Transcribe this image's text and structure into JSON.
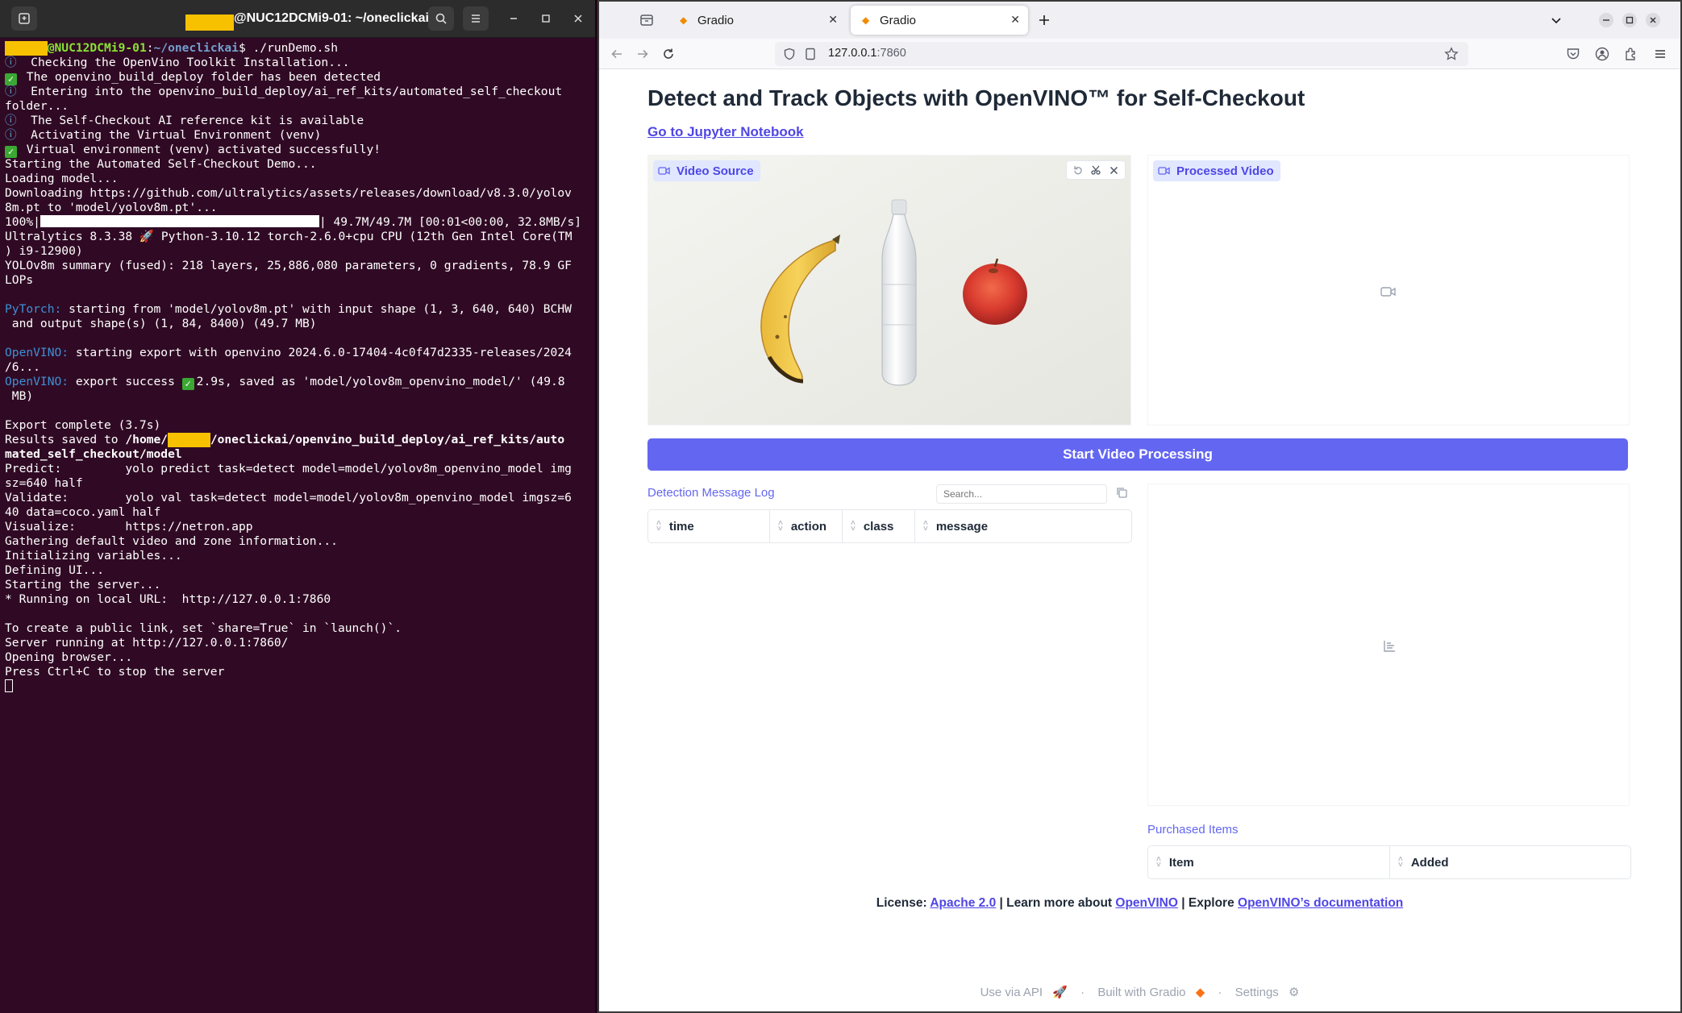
{
  "terminal": {
    "title_suffix": "@NUC12DCMi9-01: ~/oneclickai",
    "lines": [
      {
        "segs": [
          {
            "t": "      ",
            "c": "redact"
          },
          {
            "t": "@NUC12DCMi9-01",
            "c": "g"
          },
          {
            "t": ":",
            "c": ""
          },
          {
            "t": "~/oneclickai",
            "c": "b"
          },
          {
            "t": "$ ./runDemo.sh",
            "c": ""
          }
        ]
      },
      {
        "segs": [
          {
            "t": "ⓘ  ",
            "c": "info"
          },
          {
            "t": "Checking the OpenVino Toolkit Installation...",
            "c": ""
          }
        ]
      },
      {
        "segs": [
          {
            "t": "✓",
            "c": "chk"
          },
          {
            "t": " The openvino_build_deploy folder has been detected",
            "c": ""
          }
        ]
      },
      {
        "segs": [
          {
            "t": "ⓘ  ",
            "c": "info"
          },
          {
            "t": "Entering into the openvino_build_deploy/ai_ref_kits/automated_self_checkout",
            "c": ""
          }
        ]
      },
      {
        "segs": [
          {
            "t": "folder...",
            "c": ""
          }
        ]
      },
      {
        "segs": [
          {
            "t": "ⓘ  ",
            "c": "info"
          },
          {
            "t": "The Self-Checkout AI reference kit is available",
            "c": ""
          }
        ]
      },
      {
        "segs": [
          {
            "t": "ⓘ  ",
            "c": "info"
          },
          {
            "t": "Activating the Virtual Environment (venv)",
            "c": ""
          }
        ]
      },
      {
        "segs": [
          {
            "t": "✓",
            "c": "chk"
          },
          {
            "t": " Virtual environment (venv) activated successfully!",
            "c": ""
          }
        ]
      },
      {
        "segs": [
          {
            "t": "Starting the Automated Self-Checkout Demo...",
            "c": ""
          }
        ]
      },
      {
        "segs": [
          {
            "t": "Loading model...",
            "c": ""
          }
        ]
      },
      {
        "segs": [
          {
            "t": "Downloading https://github.com/ultralytics/assets/releases/download/v8.3.0/yolov",
            "c": ""
          }
        ]
      },
      {
        "segs": [
          {
            "t": "8m.pt to 'model/yolov8m.pt'...",
            "c": ""
          }
        ]
      },
      {
        "segs": [
          {
            "t": "100%|",
            "c": ""
          },
          {
            "t": "",
            "c": "pbar"
          },
          {
            "t": "| 49.7M/49.7M [00:01<00:00, 32.8MB/s]",
            "c": ""
          }
        ]
      },
      {
        "segs": [
          {
            "t": "Ultralytics 8.3.38 🚀 Python-3.10.12 torch-2.6.0+cpu CPU (12th Gen Intel Core(TM",
            "c": ""
          }
        ]
      },
      {
        "segs": [
          {
            "t": ") i9-12900)",
            "c": ""
          }
        ]
      },
      {
        "segs": [
          {
            "t": "YOLOv8m summary (fused): 218 layers, 25,886,080 parameters, 0 gradients, 78.9 GF",
            "c": ""
          }
        ]
      },
      {
        "segs": [
          {
            "t": "LOPs",
            "c": ""
          }
        ]
      },
      {
        "segs": [
          {
            "t": "",
            "c": ""
          }
        ]
      },
      {
        "segs": [
          {
            "t": "PyTorch:",
            "c": "bl"
          },
          {
            "t": " starting from 'model/yolov8m.pt' with input shape (1, 3, 640, 640) BCHW",
            "c": ""
          }
        ]
      },
      {
        "segs": [
          {
            "t": " and output shape(s) (1, 84, 8400) (49.7 MB)",
            "c": ""
          }
        ]
      },
      {
        "segs": [
          {
            "t": "",
            "c": ""
          }
        ]
      },
      {
        "segs": [
          {
            "t": "OpenVINO:",
            "c": "bl"
          },
          {
            "t": " starting export with openvino 2024.6.0-17404-4c0f47d2335-releases/2024",
            "c": ""
          }
        ]
      },
      {
        "segs": [
          {
            "t": "/6...",
            "c": ""
          }
        ]
      },
      {
        "segs": [
          {
            "t": "OpenVINO:",
            "c": "bl"
          },
          {
            "t": " export success ",
            "c": ""
          },
          {
            "t": "✓",
            "c": "chk"
          },
          {
            "t": "2.9s, saved as 'model/yolov8m_openvino_model/' (49.8",
            "c": ""
          }
        ]
      },
      {
        "segs": [
          {
            "t": " MB)",
            "c": ""
          }
        ]
      },
      {
        "segs": [
          {
            "t": "",
            "c": ""
          }
        ]
      },
      {
        "segs": [
          {
            "t": "Export complete (3.7s)",
            "c": ""
          }
        ]
      },
      {
        "segs": [
          {
            "t": "Results saved to ",
            "c": ""
          },
          {
            "t": "/home/",
            "c": "wb"
          },
          {
            "t": "      ",
            "c": "redact"
          },
          {
            "t": "/oneclickai/openvino_build_deploy/ai_ref_kits/auto",
            "c": "wb"
          }
        ]
      },
      {
        "segs": [
          {
            "t": "mated_self_checkout/model",
            "c": "wb"
          }
        ]
      },
      {
        "segs": [
          {
            "t": "Predict:         yolo predict task=detect model=model/yolov8m_openvino_model img",
            "c": ""
          }
        ]
      },
      {
        "segs": [
          {
            "t": "sz=640 half",
            "c": ""
          }
        ]
      },
      {
        "segs": [
          {
            "t": "Validate:        yolo val task=detect model=model/yolov8m_openvino_model imgsz=6",
            "c": ""
          }
        ]
      },
      {
        "segs": [
          {
            "t": "40 data=coco.yaml half",
            "c": ""
          }
        ]
      },
      {
        "segs": [
          {
            "t": "Visualize:       https://netron.app",
            "c": ""
          }
        ]
      },
      {
        "segs": [
          {
            "t": "Gathering default video and zone information...",
            "c": ""
          }
        ]
      },
      {
        "segs": [
          {
            "t": "Initializing variables...",
            "c": ""
          }
        ]
      },
      {
        "segs": [
          {
            "t": "Defining UI...",
            "c": ""
          }
        ]
      },
      {
        "segs": [
          {
            "t": "Starting the server...",
            "c": ""
          }
        ]
      },
      {
        "segs": [
          {
            "t": "* Running on local URL:  http://127.0.0.1:7860",
            "c": ""
          }
        ]
      },
      {
        "segs": [
          {
            "t": "",
            "c": ""
          }
        ]
      },
      {
        "segs": [
          {
            "t": "To create a public link, set `share=True` in `launch()`.",
            "c": ""
          }
        ]
      },
      {
        "segs": [
          {
            "t": "Server running at http://127.0.0.1:7860/",
            "c": ""
          }
        ]
      },
      {
        "segs": [
          {
            "t": "Opening browser...",
            "c": ""
          }
        ]
      },
      {
        "segs": [
          {
            "t": "Press Ctrl+C to stop the server",
            "c": ""
          }
        ]
      },
      {
        "segs": [
          {
            "t": "",
            "c": "cursor"
          }
        ]
      }
    ]
  },
  "browser": {
    "tabs": [
      {
        "label": "Gradio",
        "active": false
      },
      {
        "label": "Gradio",
        "active": true
      }
    ],
    "url_host": "127.0.0.1",
    "url_port": ":7860"
  },
  "app": {
    "title": "Detect and Track Objects with OpenVINO™ for Self-Checkout",
    "notebook_link": "Go to Jupyter Notebook",
    "video_source_label": "Video Source",
    "processed_video_label": "Processed Video",
    "start_button": "Start Video Processing",
    "detection_log_label": "Detection Message Log",
    "search_placeholder": "Search...",
    "log_columns": [
      "time",
      "action",
      "class",
      "message"
    ],
    "purchased_label": "Purchased Items",
    "purchased_columns": [
      "Item",
      "Added"
    ],
    "footer": {
      "license_prefix": "License: ",
      "license_link": "Apache 2.0",
      "learn_text": " | Learn more about ",
      "openvino_link": "OpenVINO",
      "explore_text": " | Explore ",
      "docs_link": "OpenVINO’s documentation"
    },
    "gradio_footer": {
      "api": "Use via API",
      "built": "Built with Gradio",
      "settings": "Settings",
      "sep": "·"
    }
  },
  "colors": {
    "terminal_bg": "#300a24",
    "accent": "#6366f1",
    "prompt_user": "#8ae234",
    "prompt_path": "#729fcf"
  }
}
